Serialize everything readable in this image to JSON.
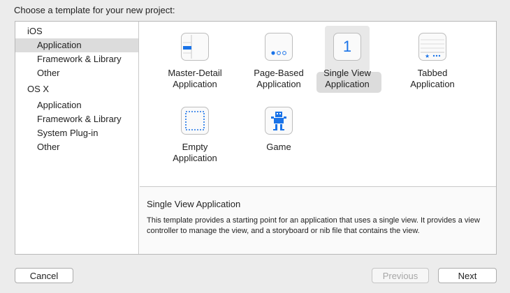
{
  "dialog": {
    "title": "Choose a template for your new project:"
  },
  "sidebar": {
    "groups": [
      {
        "label": "iOS",
        "items": [
          "Application",
          "Framework & Library",
          "Other"
        ]
      },
      {
        "label": "OS X",
        "items": [
          "Application",
          "Framework & Library",
          "System Plug-in",
          "Other"
        ]
      }
    ],
    "selected": "iOS / Application"
  },
  "templates": [
    {
      "line1": "Master-Detail",
      "line2": "Application",
      "icon": "master-detail-icon"
    },
    {
      "line1": "Page-Based",
      "line2": "Application",
      "icon": "page-based-icon"
    },
    {
      "line1": "Single View",
      "line2": "Application",
      "icon": "single-view-icon",
      "icon_text": "1",
      "selected": true
    },
    {
      "line1": "Tabbed",
      "line2": "Application",
      "icon": "tabbed-icon"
    },
    {
      "line1": "Empty",
      "line2": "Application",
      "icon": "empty-icon"
    },
    {
      "line1": "Game",
      "line2": "",
      "icon": "game-icon"
    }
  ],
  "description": {
    "title": "Single View Application",
    "text": "This template provides a starting point for an application that uses a single view. It provides a view controller to manage the view, and a storyboard or nib file that contains the view."
  },
  "buttons": {
    "cancel": "Cancel",
    "previous": "Previous",
    "next": "Next"
  },
  "colors": {
    "accent": "#1a73e8",
    "selection": "#dcdcdc",
    "border": "#b8b8b8"
  }
}
